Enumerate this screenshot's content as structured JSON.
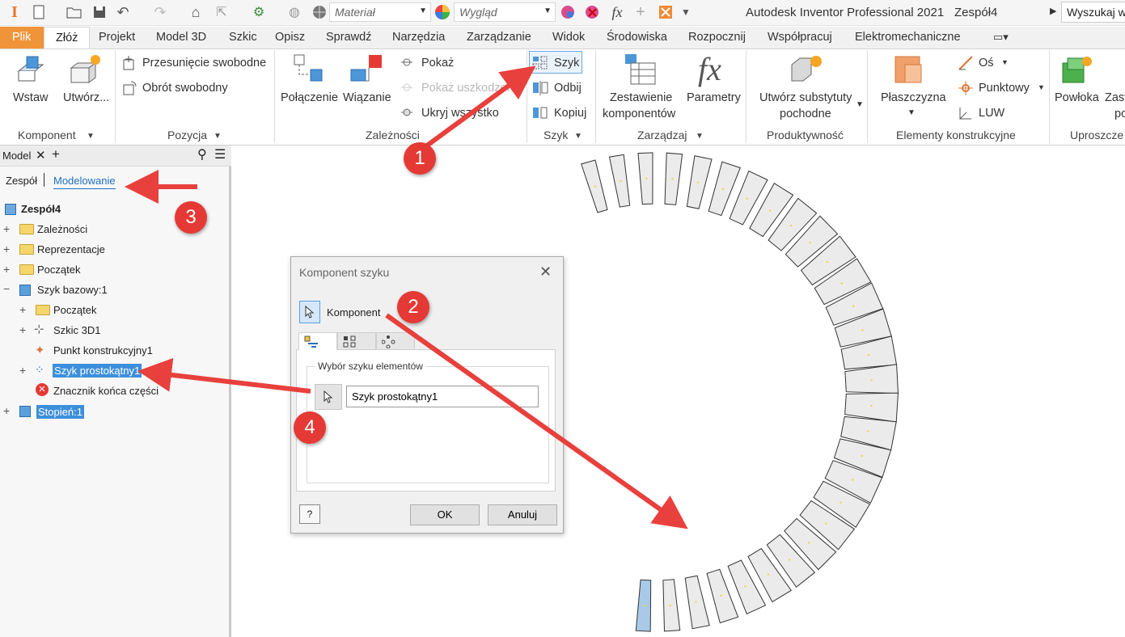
{
  "qat": {
    "material_placeholder": "Materiał",
    "appearance_placeholder": "Wygląd",
    "app_title": "Autodesk Inventor Professional 2021",
    "document_name": "Zespół4",
    "search_placeholder": "Wyszukaj w"
  },
  "tabs": [
    "Plik",
    "Złóż",
    "Projekt",
    "Model 3D",
    "Szkic",
    "Opisz",
    "Sprawdź",
    "Narzędzia",
    "Zarządzanie",
    "Widok",
    "Środowiska",
    "Rozpocznij",
    "Współpracuj",
    "Elektromechaniczne"
  ],
  "ribbon": {
    "wstaw": "Wstaw",
    "utworz": "Utwórz...",
    "przesuniecie": "Przesunięcie swobodne",
    "obrot": "Obrót swobodny",
    "polaczenie": "Połączenie",
    "wiazanie": "Wiązanie",
    "pokaz": "Pokaż",
    "pokaz_uszkodzone": "Pokaż uszkodzone",
    "ukryj_wszystko": "Ukryj wszystko",
    "szyk": "Szyk",
    "odbij": "Odbij",
    "kopiuj": "Kopiuj",
    "zestawienie_1": "Zestawienie",
    "zestawienie_2": "komponentów",
    "parametry": "Parametry",
    "substytuty_1": "Utwórz substytuty",
    "substytuty_2": "pochodne",
    "plaszczyzna": "Płaszczyzna",
    "os": "Oś",
    "punktowy": "Punktowy",
    "luw": "LUW",
    "powloka": "Powłoka",
    "zast_1": "Zast",
    "zast_2": "po",
    "groups": {
      "komponent": "Komponent",
      "pozycja": "Pozycja",
      "zaleznosci": "Zależności",
      "szyk": "Szyk",
      "zarzadzaj": "Zarządzaj",
      "produktywnosc": "Produktywność",
      "elementy": "Elementy konstrukcyjne",
      "uproszczenie": "Uproszcze"
    }
  },
  "browser": {
    "tab_model": "Model",
    "view_zespol": "Zespół",
    "view_modelowanie": "Modelowanie",
    "root": "Zespół4",
    "items": [
      "Zależności",
      "Reprezentacje",
      "Początek",
      "Szyk bazowy:1",
      "Początek",
      "Szkic 3D1",
      "Punkt konstrukcyjny1",
      "Szyk prostokątny1",
      "Znacznik końca części",
      "Stopień:1"
    ]
  },
  "dialog": {
    "title": "Komponent szyku",
    "component_label": "Komponent",
    "legend": "Wybór szyku elementów",
    "selection_value": "Szyk prostokątny1",
    "ok": "OK",
    "cancel": "Anuluj"
  },
  "annotations": [
    "1",
    "2",
    "3",
    "4"
  ],
  "colors": {
    "plik_tab": "#f0943a",
    "accent_blue": "#3d8fdc",
    "badge_red": "#e53935",
    "arrow_red": "#e8403c",
    "step_fill": "#ebebeb",
    "selected_step": "#a9c9e8"
  }
}
